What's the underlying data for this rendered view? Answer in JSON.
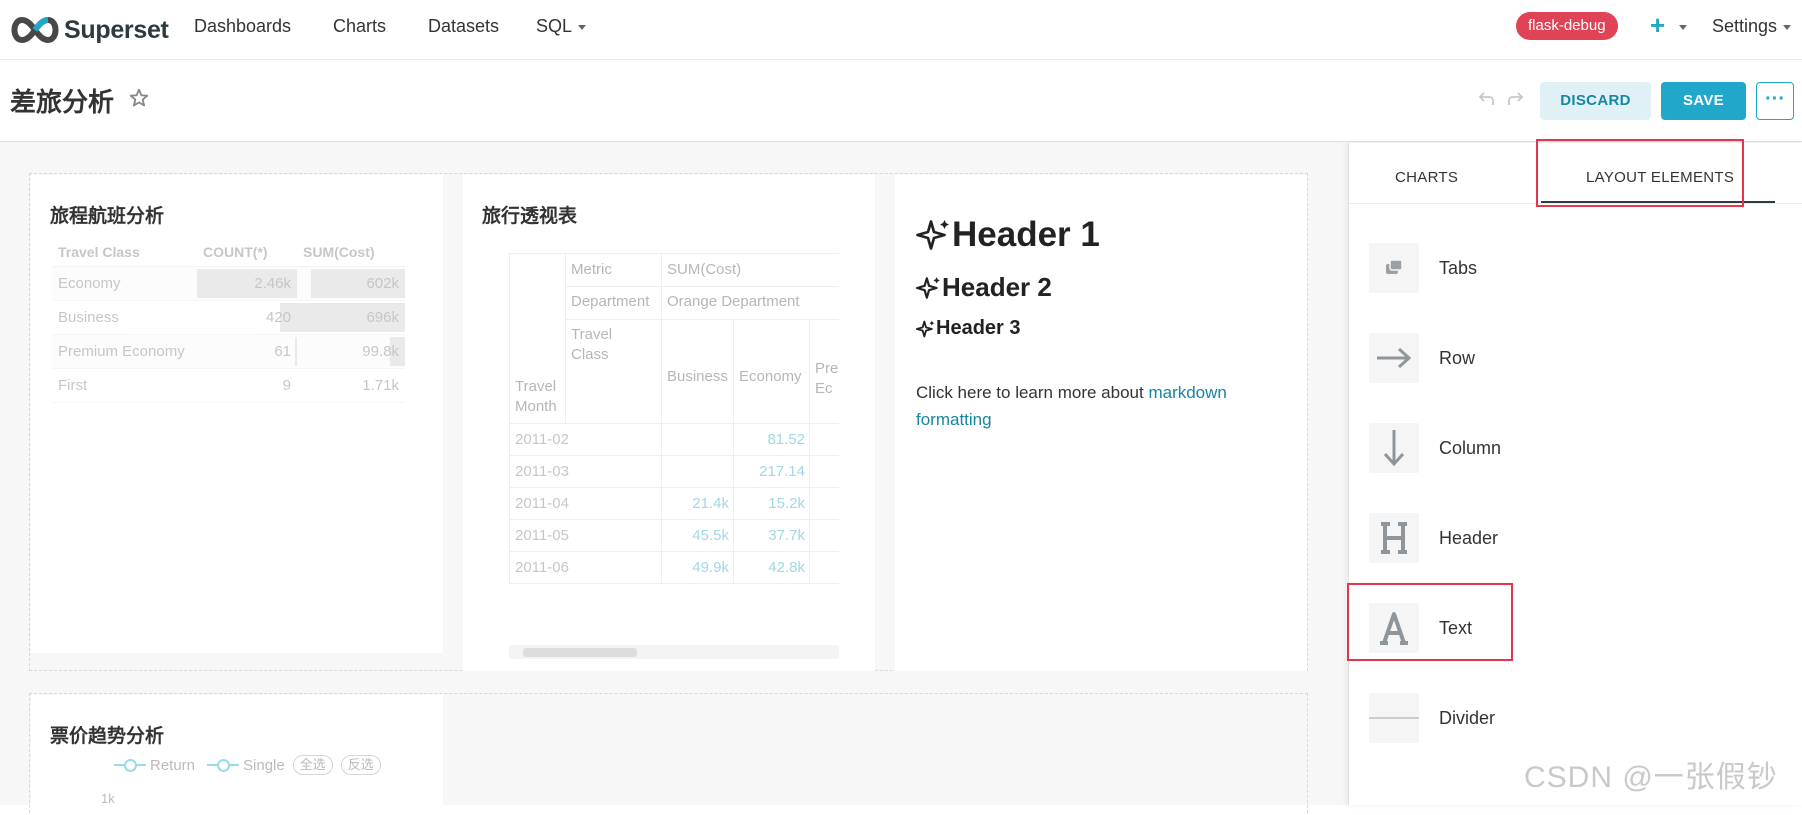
{
  "nav": {
    "brand": "Superset",
    "items": [
      "Dashboards",
      "Charts",
      "Datasets",
      "SQL"
    ],
    "env_badge": "flask-debug",
    "plus": "+",
    "settings": "Settings"
  },
  "dashboard": {
    "title": "差旅分析",
    "discard_label": "DISCARD",
    "save_label": "SAVE",
    "more_label": "···"
  },
  "charts": {
    "table": {
      "title": "旅程航班分析",
      "columns": [
        "Travel Class",
        "COUNT(*)",
        "SUM(Cost)"
      ],
      "rows": [
        {
          "class": "Economy",
          "count": "2.46k",
          "cost": "602k",
          "count_frac": 1.0,
          "cost_frac": 0.87
        },
        {
          "class": "Business",
          "count": "420",
          "cost": "696k",
          "count_frac": 0.17,
          "cost_frac": 1.0
        },
        {
          "class": "Premium Economy",
          "count": "61",
          "cost": "99.8k",
          "count_frac": 0.02,
          "cost_frac": 0.14
        },
        {
          "class": "First",
          "count": "9",
          "cost": "1.71k",
          "count_frac": 0.0,
          "cost_frac": 0.0
        }
      ]
    },
    "pivot": {
      "title": "旅行透视表",
      "metric_label": "Metric",
      "metric_value": "SUM(Cost)",
      "dept_label": "Department",
      "dept_value": "Orange Department",
      "class_label": "Travel Class",
      "month_label": "Travel Month",
      "class_cols": [
        "Business",
        "Economy",
        "Pre Ec"
      ],
      "rows": [
        {
          "month": "2011-02",
          "business": "",
          "economy": "81.52"
        },
        {
          "month": "2011-03",
          "business": "",
          "economy": "217.14"
        },
        {
          "month": "2011-04",
          "business": "21.4k",
          "economy": "15.2k"
        },
        {
          "month": "2011-05",
          "business": "45.5k",
          "economy": "37.7k"
        },
        {
          "month": "2011-06",
          "business": "49.9k",
          "economy": "42.8k"
        }
      ]
    },
    "markdown": {
      "h1": "Header 1",
      "h2": "Header 2",
      "h3": "Header 3",
      "para_text": "Click here to learn more about ",
      "link_text": "markdown formatting"
    },
    "trend": {
      "title": "票价趋势分析",
      "legend": [
        "Return",
        "Single"
      ],
      "select_all": "全选",
      "invert": "反选",
      "y_tick": "1k"
    }
  },
  "panel": {
    "tabs": [
      "CHARTS",
      "LAYOUT ELEMENTS"
    ],
    "elements": [
      {
        "label": "Tabs",
        "icon": "tabs-icon"
      },
      {
        "label": "Row",
        "icon": "arrow-right-icon"
      },
      {
        "label": "Column",
        "icon": "arrow-down-icon"
      },
      {
        "label": "Header",
        "icon": "header-h-icon"
      },
      {
        "label": "Text",
        "icon": "text-a-icon"
      },
      {
        "label": "Divider",
        "icon": "divider-icon"
      }
    ]
  },
  "watermark": "CSDN @一张假钞"
}
